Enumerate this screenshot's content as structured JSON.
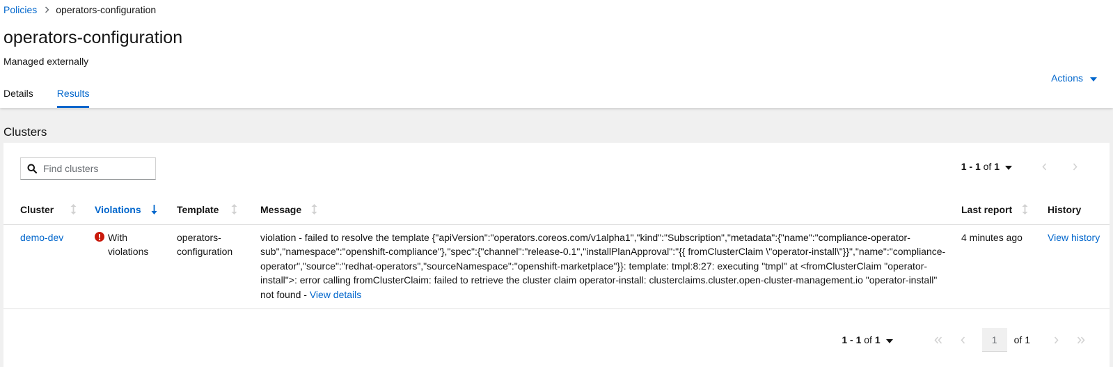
{
  "breadcrumb": {
    "parent": "Policies",
    "current": "operators-configuration"
  },
  "header": {
    "title": "operators-configuration",
    "subtitle": "Managed externally",
    "actions_label": "Actions"
  },
  "tabs": [
    {
      "label": "Details"
    },
    {
      "label": "Results"
    }
  ],
  "section": {
    "title": "Clusters"
  },
  "search": {
    "placeholder": "Find clusters"
  },
  "pagination_top": {
    "range": "1 - 1",
    "of": "of",
    "total": "1"
  },
  "table": {
    "headers": {
      "cluster": "Cluster",
      "violations": "Violations",
      "template": "Template",
      "message": "Message",
      "last_report": "Last report",
      "history": "History"
    },
    "rows": [
      {
        "cluster": "demo-dev",
        "violations": "With violations",
        "template": "operators-configuration",
        "message": "violation - failed to resolve the template {\"apiVersion\":\"operators.coreos.com/v1alpha1\",\"kind\":\"Subscription\",\"metadata\":{\"name\":\"compliance-operator-sub\",\"namespace\":\"openshift-compliance\"},\"spec\":{\"channel\":\"release-0.1\",\"installPlanApproval\":\"{{ fromClusterClaim \\\"operator-install\\\"}}\",\"name\":\"compliance-operator\",\"source\":\"redhat-operators\",\"sourceNamespace\":\"openshift-marketplace\"}}: template: tmpl:8:27: executing \"tmpl\" at <fromClusterClaim \"operator-install\">: error calling fromClusterClaim: failed to retrieve the cluster claim operator-install: clusterclaims.cluster.open-cluster-management.io \"operator-install\" not found - ",
        "message_link": "View details",
        "last_report": "4 minutes ago",
        "history": "View history"
      }
    ]
  },
  "pagination_bottom": {
    "range": "1 - 1",
    "of": "of",
    "total": "1",
    "page": "1",
    "of_pages": "of 1"
  },
  "colors": {
    "link": "#0066cc",
    "danger": "#c9190b",
    "background": "#f0f0f0"
  }
}
